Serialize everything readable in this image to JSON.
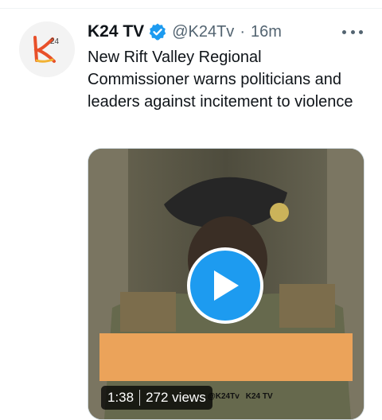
{
  "tweet": {
    "author_name": "K24 TV",
    "handle": "@K24Tv",
    "separator": "·",
    "time": "16m",
    "text": "New Rift Valley Regional Commissioner warns politicians and leaders against incitement to violence"
  },
  "avatar": {
    "logo_text": "k",
    "logo_sub": "24"
  },
  "video": {
    "duration": "1:38",
    "views": "272 views",
    "overlay": {
      "twitter": "@K24Tv",
      "youtube": "K24 TV"
    }
  },
  "colors": {
    "verified": "#1d9bf0",
    "play_button": "#1d9bf0",
    "lower_third": "#eba35a"
  }
}
